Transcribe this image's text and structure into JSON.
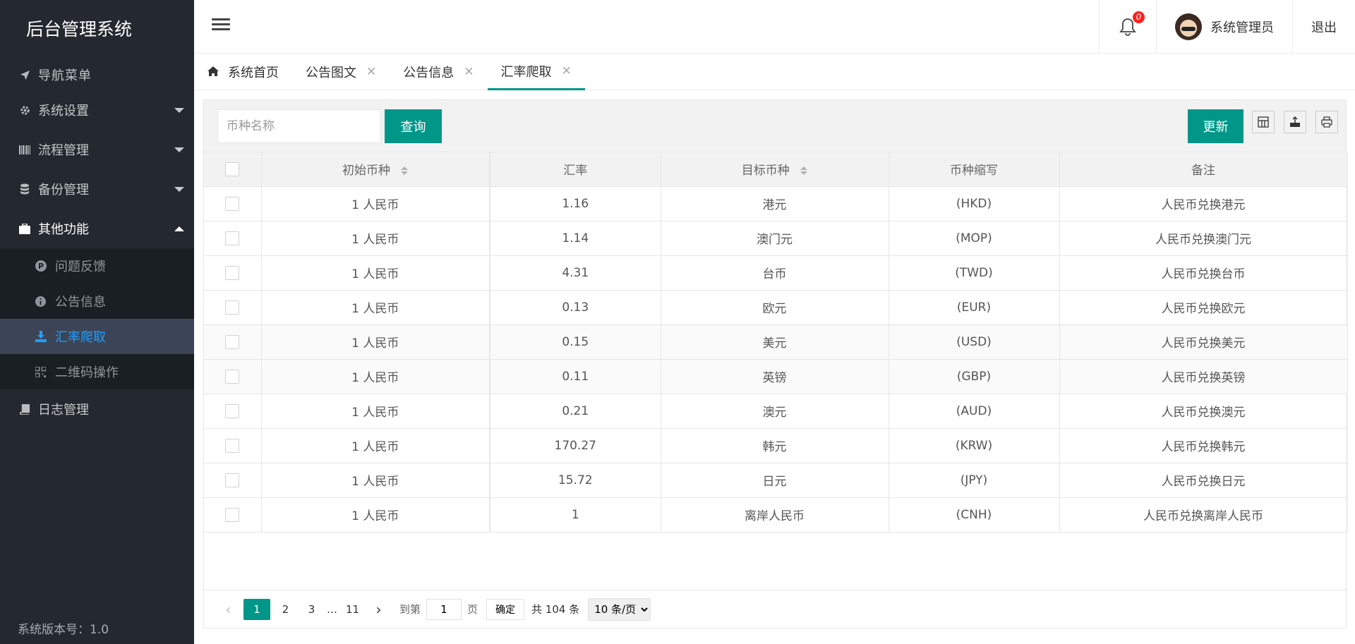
{
  "app": {
    "title": "后台管理系统",
    "version_label": "系统版本号：1.0"
  },
  "sidebar": {
    "nav_header": "导航菜单",
    "items": [
      {
        "label": "系统设置",
        "icon": "gear-icon"
      },
      {
        "label": "流程管理",
        "icon": "barcode-icon"
      },
      {
        "label": "备份管理",
        "icon": "database-icon"
      },
      {
        "label": "其他功能",
        "icon": "briefcase-icon"
      },
      {
        "label": "日志管理",
        "icon": "book-icon"
      }
    ],
    "sub_items": [
      {
        "label": "问题反馈",
        "icon": "p-circle-icon"
      },
      {
        "label": "公告信息",
        "icon": "info-circle-icon"
      },
      {
        "label": "汇率爬取",
        "icon": "download-icon"
      },
      {
        "label": "二维码操作",
        "icon": "qrcode-icon"
      }
    ]
  },
  "header": {
    "notification_count": "0",
    "user_name": "系统管理员",
    "logout_label": "退出"
  },
  "tabs": [
    {
      "label": "系统首页"
    },
    {
      "label": "公告图文"
    },
    {
      "label": "公告信息"
    },
    {
      "label": "汇率爬取"
    }
  ],
  "toolbar": {
    "search_placeholder": "币种名称",
    "search_value": "",
    "query_label": "查询",
    "update_label": "更新"
  },
  "table": {
    "columns": [
      "初始币种",
      "汇率",
      "目标币种",
      "币种缩写",
      "备注"
    ],
    "rows": [
      [
        "1 人民币",
        "1.16",
        "港元",
        "(HKD)",
        "人民币兑换港元"
      ],
      [
        "1 人民币",
        "1.14",
        "澳门元",
        "(MOP)",
        "人民币兑换澳门元"
      ],
      [
        "1 人民币",
        "4.31",
        "台币",
        "(TWD)",
        "人民币兑换台币"
      ],
      [
        "1 人民币",
        "0.13",
        "欧元",
        "(EUR)",
        "人民币兑换欧元"
      ],
      [
        "1 人民币",
        "0.15",
        "美元",
        "(USD)",
        "人民币兑换美元"
      ],
      [
        "1 人民币",
        "0.11",
        "英镑",
        "(GBP)",
        "人民币兑换英镑"
      ],
      [
        "1 人民币",
        "0.21",
        "澳元",
        "(AUD)",
        "人民币兑换澳元"
      ],
      [
        "1 人民币",
        "170.27",
        "韩元",
        "(KRW)",
        "人民币兑换韩元"
      ],
      [
        "1 人民币",
        "15.72",
        "日元",
        "(JPY)",
        "人民币兑换日元"
      ],
      [
        "1 人民币",
        "1",
        "离岸人民币",
        "(CNH)",
        "人民币兑换离岸人民币"
      ]
    ]
  },
  "pagination": {
    "pages": [
      "1",
      "2",
      "3"
    ],
    "ellipsis": "…",
    "last_page": "11",
    "goto_label": "到第",
    "goto_value": "1",
    "page_unit": "页",
    "confirm_label": "确定",
    "total_label": "共 104 条",
    "page_size": "10 条/页"
  },
  "colors": {
    "accent": "#009688",
    "sidebar_bg": "#23292e",
    "active_sub": "#1f9fff",
    "badge": "#ff2020"
  }
}
